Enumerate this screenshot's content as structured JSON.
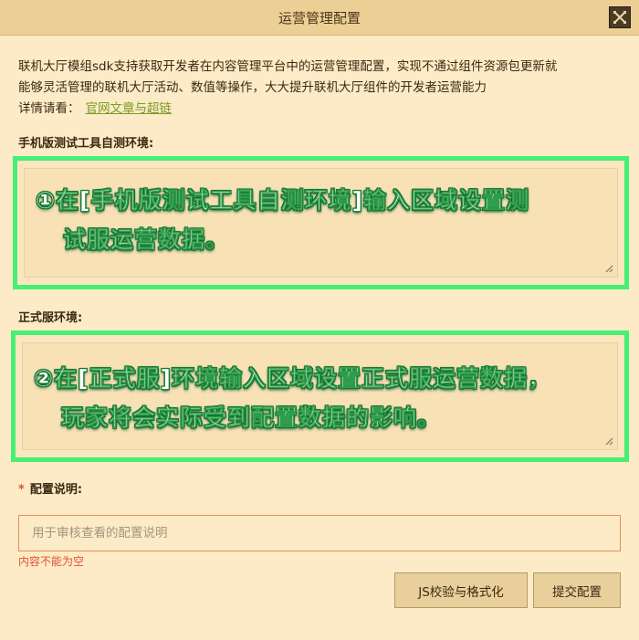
{
  "window": {
    "title": "运营管理配置",
    "close_icon": "close-icon"
  },
  "intro": {
    "line1": "联机大厅模组sdk支持获取开发者在内容管理平台中的运营管理配置，实现不通过组件资源包更新就",
    "line2": "能够灵活管理的联机大厅活动、数值等操作，大大提升联机大厅组件的开发者运营能力",
    "details_prefix": "详情请看：",
    "details_link": "官网文章与超链"
  },
  "test_env": {
    "label": "手机版测试工具自测环境:",
    "overlay_line1": "①在[手机版测试工具自测环境]输入区域设置测",
    "overlay_line2": "试服运营数据。"
  },
  "prod_env": {
    "label": "正式服环境:",
    "overlay_line1": "②在[正式服]环境输入区域设置正式服运营数据，",
    "overlay_line2": "玩家将会实际受到配置数据的影响。"
  },
  "config_desc": {
    "required_mark": "*",
    "label": "配置说明:",
    "placeholder": "用于审核查看的配置说明",
    "error": "内容不能为空"
  },
  "buttons": {
    "validate": "JS校验与格式化",
    "submit": "提交配置"
  },
  "colors": {
    "background": "#fcebc6",
    "titlebar": "#eccf95",
    "highlight_border": "#46ef76",
    "link": "#7a9c2a",
    "error": "#e0522f"
  }
}
